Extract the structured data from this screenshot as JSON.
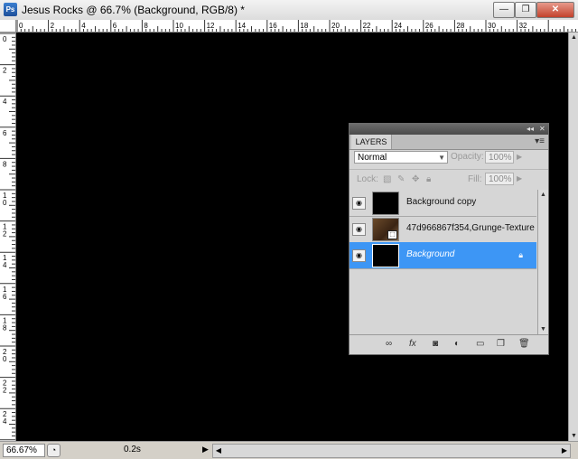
{
  "window": {
    "app_icon_label": "Ps",
    "title": "Jesus Rocks @ 66.7% (Background, RGB/8) *",
    "minimize_label": "—",
    "maximize_label": "❐",
    "close_label": "✕"
  },
  "rulers": {
    "top_ticks": [
      "0",
      "2",
      "4",
      "6",
      "8",
      "10",
      "12",
      "14",
      "16",
      "18",
      "20",
      "22",
      "24",
      "26",
      "28",
      "30",
      "32"
    ],
    "left_ticks": [
      "0",
      "2",
      "4",
      "6",
      "8",
      "10",
      "12",
      "14",
      "16",
      "18",
      "20",
      "22",
      "24",
      "26"
    ]
  },
  "statusbar": {
    "zoom": "66.67%",
    "timing": "0.2s",
    "arrow": "▶"
  },
  "layers_panel": {
    "tab_label": "LAYERS",
    "collapse_label": "◂◂",
    "close_label": "✕",
    "menu_label": "▾≡",
    "blend_mode": "Normal",
    "opacity_label": "Opacity:",
    "opacity_value": "100%",
    "lock_label": "Lock:",
    "fill_label": "Fill:",
    "fill_value": "100%",
    "layers": [
      {
        "name": "Background copy",
        "selected": false
      },
      {
        "name": "47d966867f354,Grunge-Texture",
        "selected": false
      },
      {
        "name": "Background",
        "selected": true
      }
    ]
  },
  "icons": {
    "eye": "eye-icon",
    "smart_object": "smart-object-icon",
    "lock": "lock-icon",
    "link_layers": "link-icon",
    "fx": "fx-icon",
    "mask": "mask-icon",
    "adjustment": "adjustment-icon",
    "group": "folder-icon",
    "new_layer": "new-layer-icon",
    "delete": "trash-icon"
  }
}
